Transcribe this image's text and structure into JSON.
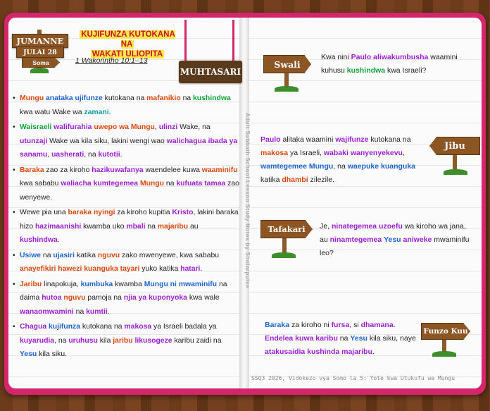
{
  "header": {
    "day": "JUMANNE",
    "date": "JULAI 28",
    "read_label": "Soma",
    "title_line1": "KUJIFUNZA KUTOKANA NA",
    "title_line2": "WAKATI ULIOPITA",
    "reference": "1 Wakorintho 10:1–13",
    "summary_label": "MUHTASARI"
  },
  "side_text": "Adult Sabbath School Lesson Study Notes by Sholarpulse",
  "points": [
    [
      "Mungu",
      "o",
      " "
    ],
    [
      "anataka",
      "b",
      " "
    ],
    [
      "ujifunze",
      "b",
      " kutokana na "
    ],
    [
      "mafanikio",
      "o",
      " na "
    ],
    [
      "kushindwa",
      "g",
      ""
    ]
  ],
  "bullets": [
    [
      {
        "t": "Mungu",
        "c": "o"
      },
      {
        "t": " "
      },
      {
        "t": "anataka",
        "c": "b"
      },
      {
        "t": " "
      },
      {
        "t": "ujifunze",
        "c": "b"
      },
      {
        "t": " kutokana na "
      },
      {
        "t": "mafanikio",
        "c": "o"
      },
      {
        "t": " na "
      },
      {
        "t": "kushindwa",
        "c": "g"
      },
      {
        "t": " kwa watu Wake wa "
      },
      {
        "t": "zamani",
        "c": "t"
      },
      {
        "t": "."
      }
    ],
    [
      {
        "t": "Waisraeli",
        "c": "g"
      },
      {
        "t": " "
      },
      {
        "t": "walifurahia",
        "c": "p"
      },
      {
        "t": " "
      },
      {
        "t": "uwepo wa Mungu",
        "c": "o"
      },
      {
        "t": ", "
      },
      {
        "t": "ulinzi",
        "c": "p"
      },
      {
        "t": " Wake, na "
      },
      {
        "t": "utunzaji",
        "c": "p"
      },
      {
        "t": " Wake wa kila siku, lakini wengi wao "
      },
      {
        "t": "walichagua",
        "c": "p"
      },
      {
        "t": " "
      },
      {
        "t": "ibada ya sanamu",
        "c": "p"
      },
      {
        "t": ", "
      },
      {
        "t": "uasherati",
        "c": "p"
      },
      {
        "t": ", na "
      },
      {
        "t": "kutotii",
        "c": "p"
      },
      {
        "t": "."
      }
    ],
    [
      {
        "t": "Baraka",
        "c": "o"
      },
      {
        "t": " zao za kiroho "
      },
      {
        "t": "hazikuwafanya",
        "c": "p"
      },
      {
        "t": " waendelee kuwa "
      },
      {
        "t": "waaminifu",
        "c": "o"
      },
      {
        "t": " kwa sababu "
      },
      {
        "t": "waliacha",
        "c": "p"
      },
      {
        "t": " "
      },
      {
        "t": "kumtegemea",
        "c": "p"
      },
      {
        "t": " "
      },
      {
        "t": "Mungu",
        "c": "o"
      },
      {
        "t": " na "
      },
      {
        "t": "kufuata",
        "c": "p"
      },
      {
        "t": " "
      },
      {
        "t": "tamaa",
        "c": "p"
      },
      {
        "t": " zao wenyewe."
      }
    ],
    [
      {
        "t": "Wewe pia una "
      },
      {
        "t": "baraka nyingi",
        "c": "o"
      },
      {
        "t": " za kiroho kupitia "
      },
      {
        "t": "Kristo",
        "c": "p"
      },
      {
        "t": ", lakini baraka hizo "
      },
      {
        "t": "hazimaanishi",
        "c": "p"
      },
      {
        "t": " kwamba uko "
      },
      {
        "t": "mbali",
        "c": "p"
      },
      {
        "t": " na "
      },
      {
        "t": "majaribu",
        "c": "o"
      },
      {
        "t": " au "
      },
      {
        "t": "kushindwa",
        "c": "p"
      },
      {
        "t": "."
      }
    ],
    [
      {
        "t": "Usiwe",
        "c": "b"
      },
      {
        "t": " na "
      },
      {
        "t": "ujasiri",
        "c": "b"
      },
      {
        "t": " katika "
      },
      {
        "t": "nguvu",
        "c": "o"
      },
      {
        "t": " zako mwenyewe, kwa sababu "
      },
      {
        "t": "anayefikiri hawezi kuanguka tayari",
        "c": "o"
      },
      {
        "t": " yuko katika "
      },
      {
        "t": "hatari",
        "c": "p"
      },
      {
        "t": "."
      }
    ],
    [
      {
        "t": "Jaribu",
        "c": "o"
      },
      {
        "t": " linapokuja, "
      },
      {
        "t": "kumbuka",
        "c": "b"
      },
      {
        "t": " kwamba "
      },
      {
        "t": "Mungu ni mwaminifu",
        "c": "b"
      },
      {
        "t": " na daima "
      },
      {
        "t": "hutoa",
        "c": "p"
      },
      {
        "t": " "
      },
      {
        "t": "nguvu",
        "c": "o"
      },
      {
        "t": " pamoja na "
      },
      {
        "t": "njia ya kuponyoka",
        "c": "p"
      },
      {
        "t": " kwa wale "
      },
      {
        "t": "wanaomwamini",
        "c": "p"
      },
      {
        "t": " na "
      },
      {
        "t": "kumtii",
        "c": "p"
      },
      {
        "t": "."
      }
    ],
    [
      {
        "t": "Chagua",
        "c": "p"
      },
      {
        "t": " "
      },
      {
        "t": "kujifunza",
        "c": "b"
      },
      {
        "t": " kutokana na "
      },
      {
        "t": "makosa",
        "c": "p"
      },
      {
        "t": " ya Israeli badala ya "
      },
      {
        "t": "kuyarudia",
        "c": "p"
      },
      {
        "t": ", na "
      },
      {
        "t": "uruhusu",
        "c": "p"
      },
      {
        "t": " kila "
      },
      {
        "t": "jaribu",
        "c": "o"
      },
      {
        "t": " "
      },
      {
        "t": "likusogeze",
        "c": "p"
      },
      {
        "t": " karibu zaidi na "
      },
      {
        "t": "Yesu",
        "c": "b"
      },
      {
        "t": " kila siku."
      }
    ]
  ],
  "sections": {
    "question_label": "Swali",
    "question": [
      {
        "t": "Kwa nini "
      },
      {
        "t": "Paulo",
        "c": "p"
      },
      {
        "t": " "
      },
      {
        "t": "aliwakumbusha",
        "c": "p"
      },
      {
        "t": " waamini kuhusu "
      },
      {
        "t": "kushindwa",
        "c": "g"
      },
      {
        "t": " kwa Israeli?"
      }
    ],
    "answer_label": "Jibu",
    "answer": [
      {
        "t": "Paulo",
        "c": "p"
      },
      {
        "t": " alitaka waamini "
      },
      {
        "t": "wajifunze",
        "c": "p"
      },
      {
        "t": " kutokana na "
      },
      {
        "t": "makosa",
        "c": "o"
      },
      {
        "t": " ya Israeli, "
      },
      {
        "t": "wabaki wanyenyekevu",
        "c": "p"
      },
      {
        "t": ", "
      },
      {
        "t": "wamtegemee Mungu",
        "c": "b"
      },
      {
        "t": ", na "
      },
      {
        "t": "waepuke kuanguka",
        "c": "b"
      },
      {
        "t": " katika "
      },
      {
        "t": "dhambi",
        "c": "o"
      },
      {
        "t": " zilezile."
      }
    ],
    "reflect_label": "Tafakari",
    "reflect": [
      {
        "t": "Je, "
      },
      {
        "t": "ninategemea uzoefu",
        "c": "p"
      },
      {
        "t": " wa kiroho wa jana, au "
      },
      {
        "t": "ninamtegemea",
        "c": "p"
      },
      {
        "t": " "
      },
      {
        "t": "Yesu",
        "c": "b"
      },
      {
        "t": " "
      },
      {
        "t": "aniweke",
        "c": "p"
      },
      {
        "t": " mwaminifu leo?"
      }
    ],
    "takeaway_label": "Funzo Kuu",
    "takeaway": [
      {
        "t": "Baraka",
        "c": "b"
      },
      {
        "t": " za kiroho ni "
      },
      {
        "t": "fursa",
        "c": "p"
      },
      {
        "t": ", si "
      },
      {
        "t": "dhamana",
        "c": "p"
      },
      {
        "t": ". "
      },
      {
        "t": "Endelea kuwa karibu",
        "c": "p"
      },
      {
        "t": " na "
      },
      {
        "t": "Yesu",
        "c": "b"
      },
      {
        "t": " kila siku, naye "
      },
      {
        "t": "atakusaidia kushinda majaribu",
        "c": "p"
      },
      {
        "t": "."
      }
    ]
  },
  "footer": "SSQ3 2026, Vidokezo vya Somo la 5: Yote kwa Utukufu wa Mungu",
  "colors": {
    "cover": "#d6266b",
    "sign": "#8b5524",
    "title": "#c8102e",
    "highlight": "#ffe94a"
  }
}
